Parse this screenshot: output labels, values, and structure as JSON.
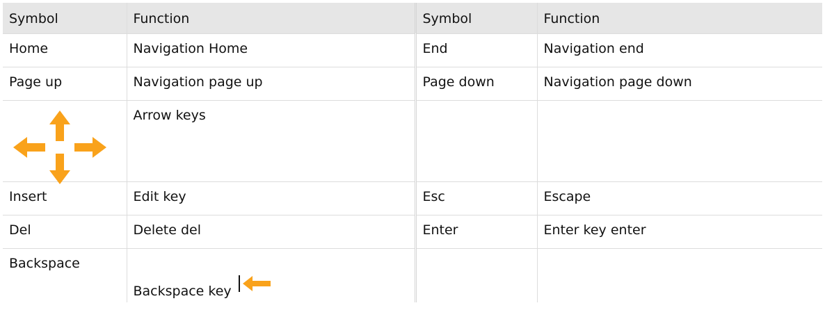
{
  "header": {
    "symbol_1": "Symbol",
    "function_1": "Function",
    "symbol_2": "Symbol",
    "function_2": "Function"
  },
  "rows": [
    {
      "symbol_1": "Home",
      "function_1": "Navigation Home",
      "symbol_2": "End",
      "function_2": "Navigation end"
    },
    {
      "symbol_1": "Page up",
      "function_1": "Navigation page up",
      "symbol_2": "Page down",
      "function_2": "Navigation page down"
    },
    {
      "symbol_1_icon": "arrow-keys-icon",
      "function_1": "Arrow keys",
      "symbol_2": "",
      "function_2": ""
    },
    {
      "symbol_1": "Insert",
      "function_1": "Edit key",
      "symbol_2": "Esc",
      "function_2": "Escape"
    },
    {
      "symbol_1": "Del",
      "function_1": "Delete del",
      "symbol_2": "Enter",
      "function_2": "Enter key enter"
    },
    {
      "symbol_1": "Backspace",
      "function_1": "Backspace key",
      "function_1_icon": "backspace-arrow-icon",
      "symbol_2": "",
      "function_2": ""
    }
  ],
  "colors": {
    "header_bg": "#e6e6e6",
    "icon_orange": "#f9a21b",
    "grid": "#dcdcdc"
  }
}
